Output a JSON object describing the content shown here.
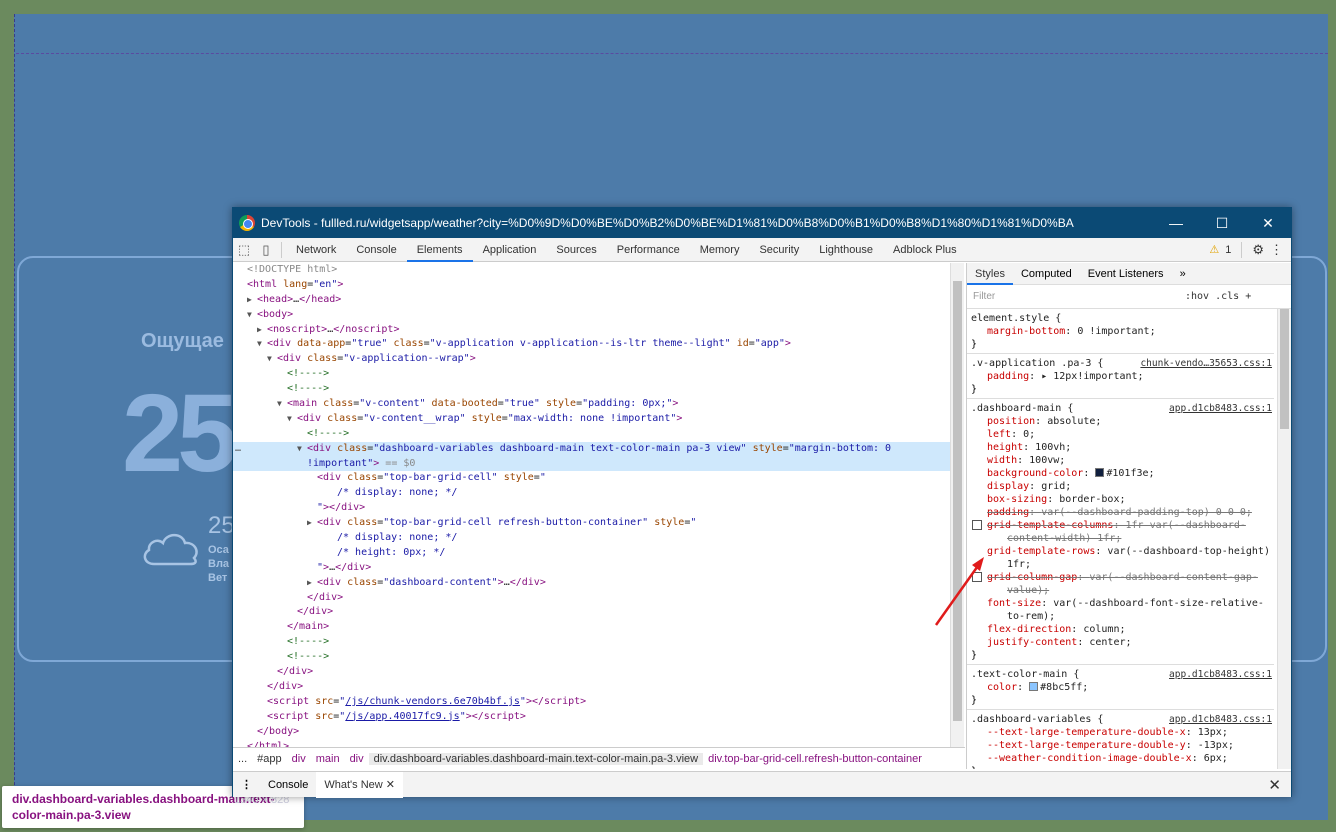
{
  "background": {
    "feels_text": "Ощущае",
    "big_temp": "25",
    "small_temp": "25",
    "lines": [
      "Оса",
      "Вла",
      "Вет"
    ],
    "tooltip": "div.dashboard-variables.dashboard-main.text-color-main.pa-3.view",
    "size": "1340 × 828"
  },
  "window": {
    "title": "DevTools - fullled.ru/widgetsapp/weather?city=%D0%9D%D0%BE%D0%B2%D0%BE%D1%81%D0%B8%D0%B1%D0%B8%D1%80%D1%81%D0%BA",
    "minimize": "—",
    "maximize": "☐",
    "close": "✕"
  },
  "tabs": [
    "Network",
    "Console",
    "Elements",
    "Application",
    "Sources",
    "Performance",
    "Memory",
    "Security",
    "Lighthouse",
    "Adblock Plus"
  ],
  "active_tab": "Elements",
  "warnings": "1",
  "elements": [
    {
      "i": 0,
      "h": "<span class='dim'>&lt;!DOCTYPE html&gt;</span>"
    },
    {
      "i": 0,
      "h": "<span class='tag'>&lt;html</span> <span class='an'>lang</span>=<span class='av'>\"en\"</span><span class='tag'>&gt;</span>"
    },
    {
      "i": 1,
      "t": "▶",
      "h": "<span class='tag'>&lt;head&gt;</span>…<span class='tag'>&lt;/head&gt;</span>"
    },
    {
      "i": 1,
      "t": "▼",
      "h": "<span class='tag'>&lt;body&gt;</span>"
    },
    {
      "i": 2,
      "t": "▶",
      "h": "<span class='tag'>&lt;noscript&gt;</span>…<span class='tag'>&lt;/noscript&gt;</span>"
    },
    {
      "i": 2,
      "t": "▼",
      "h": "<span class='tag'>&lt;div</span> <span class='an'>data-app</span>=<span class='av'>\"true\"</span> <span class='an'>class</span>=<span class='av'>\"v-application v-application--is-ltr theme--light\"</span> <span class='an'>id</span>=<span class='av'>\"app\"</span><span class='tag'>&gt;</span>"
    },
    {
      "i": 3,
      "t": "▼",
      "h": "<span class='tag'>&lt;div</span> <span class='an'>class</span>=<span class='av'>\"v-application--wrap\"</span><span class='tag'>&gt;</span>"
    },
    {
      "i": 4,
      "h": "<span class='cm'>&lt;!----&gt;</span>"
    },
    {
      "i": 4,
      "h": "<span class='cm'>&lt;!----&gt;</span>"
    },
    {
      "i": 4,
      "t": "▼",
      "h": "<span class='tag'>&lt;main</span> <span class='an'>class</span>=<span class='av'>\"v-content\"</span> <span class='an'>data-booted</span>=<span class='av'>\"true\"</span> <span class='an'>style</span>=<span class='av'>\"padding: 0px;\"</span><span class='tag'>&gt;</span>"
    },
    {
      "i": 5,
      "t": "▼",
      "h": "<span class='tag'>&lt;div</span> <span class='an'>class</span>=<span class='av'>\"v-content__wrap\"</span> <span class='an'>style</span>=<span class='av'>\"max-width: none !important\"</span><span class='tag'>&gt;</span>"
    },
    {
      "i": 6,
      "h": "<span class='cm'>&lt;!----&gt;</span>"
    },
    {
      "i": 6,
      "t": "▼",
      "sel": true,
      "h": "<span class='tag'>&lt;div</span> <span class='an'>class</span>=<span class='av'>\"dashboard-variables dashboard-main text-color-main pa-3 view\"</span> <span class='an'>style</span>=<span class='av'>\"margin-bottom: 0</span>"
    },
    {
      "i": 6,
      "sel": true,
      "h": "<span class='av'>!important\"</span><span class='tag'>&gt;</span> <span class='dim'>== $0</span>"
    },
    {
      "i": 7,
      "h": "<span class='tag'>&lt;div</span> <span class='an'>class</span>=<span class='av'>\"top-bar-grid-cell\"</span> <span class='an'>style</span>=<span class='av'>\"</span>"
    },
    {
      "i": 9,
      "h": "<span class='av'>/* display: none; */</span>"
    },
    {
      "i": 7,
      "h": "<span class='av'>\"</span><span class='tag'>&gt;&lt;/div&gt;</span>"
    },
    {
      "i": 7,
      "t": "▶",
      "h": "<span class='tag'>&lt;div</span> <span class='an'>class</span>=<span class='av'>\"top-bar-grid-cell refresh-button-container\"</span> <span class='an'>style</span>=<span class='av'>\"</span>"
    },
    {
      "i": 9,
      "h": "<span class='av'>/* display: none; */</span>"
    },
    {
      "i": 9,
      "h": "<span class='av'>/* height: 0px; */</span>"
    },
    {
      "i": 7,
      "h": "<span class='av'>\"</span><span class='tag'>&gt;</span>…<span class='tag'>&lt;/div&gt;</span>"
    },
    {
      "i": 7,
      "t": "▶",
      "h": "<span class='tag'>&lt;div</span> <span class='an'>class</span>=<span class='av'>\"dashboard-content\"</span><span class='tag'>&gt;</span>…<span class='tag'>&lt;/div&gt;</span>"
    },
    {
      "i": 6,
      "h": "<span class='tag'>&lt;/div&gt;</span>"
    },
    {
      "i": 5,
      "h": "<span class='tag'>&lt;/div&gt;</span>"
    },
    {
      "i": 4,
      "h": "<span class='tag'>&lt;/main&gt;</span>"
    },
    {
      "i": 4,
      "h": "<span class='cm'>&lt;!----&gt;</span>"
    },
    {
      "i": 4,
      "h": "<span class='cm'>&lt;!----&gt;</span>"
    },
    {
      "i": 3,
      "h": "<span class='tag'>&lt;/div&gt;</span>"
    },
    {
      "i": 2,
      "h": "<span class='tag'>&lt;/div&gt;</span>"
    },
    {
      "i": 2,
      "h": "<span class='tag'>&lt;script</span> <span class='an'>src</span>=<span class='av'>\"<span class='lk'>/js/chunk-vendors.6e70b4bf.js</span>\"</span><span class='tag'>&gt;&lt;/script&gt;</span>"
    },
    {
      "i": 2,
      "h": "<span class='tag'>&lt;script</span> <span class='an'>src</span>=<span class='av'>\"<span class='lk'>/js/app.40017fc9.js</span>\"</span><span class='tag'>&gt;&lt;/script&gt;</span>"
    },
    {
      "i": 1,
      "h": "<span class='tag'>&lt;/body&gt;</span>"
    },
    {
      "i": 0,
      "h": "<span class='tag'>&lt;/html&gt;</span>"
    }
  ],
  "breadcrumbs": [
    "...",
    "#app",
    "div",
    "main",
    "div",
    "div.dashboard-variables.dashboard-main.text-color-main.pa-3.view",
    "div.top-bar-grid-cell.refresh-button-container"
  ],
  "styles_tabs": [
    "Styles",
    "Computed",
    "Event Listeners",
    "»"
  ],
  "filter_placeholder": "Filter",
  "hov": ":hov",
  "cls": ".cls",
  "rules": [
    {
      "sel": "element.style {",
      "src": "",
      "decls": [
        {
          "p": "margin-bottom",
          "v": "0 !important;"
        }
      ]
    },
    {
      "sel": ".v-application .pa-3 {",
      "src": "chunk-vendo…35653.css:1",
      "decls": [
        {
          "p": "padding",
          "v": "▸ 12px!important;"
        }
      ]
    },
    {
      "sel": ".dashboard-main {",
      "src": "app.d1cb8483.css:1",
      "decls": [
        {
          "p": "position",
          "v": "absolute;"
        },
        {
          "p": "left",
          "v": "0;"
        },
        {
          "p": "height",
          "v": "100vh;"
        },
        {
          "p": "width",
          "v": "100vw;"
        },
        {
          "p": "background-color",
          "v": "#101f3e;",
          "sw": "#101f3e"
        },
        {
          "p": "display",
          "v": "grid;"
        },
        {
          "p": "box-sizing",
          "v": "border-box;"
        },
        {
          "p": "padding",
          "v": "var(--dashboard-padding-top) 0 0 0;",
          "s": true
        },
        {
          "p": "grid-template-columns",
          "v": "1fr var(--dashboard-",
          "s": true,
          "cb": true
        },
        {
          "c": "content-width) 1fr;",
          "s": true
        },
        {
          "p": "grid-template-rows",
          "v": "var(--dashboard-top-height)"
        },
        {
          "c": "1fr;"
        },
        {
          "p": "grid-column-gap",
          "v": "var(--dashboard-content-gap-",
          "s": true,
          "cb": true
        },
        {
          "c": "value);",
          "s": true
        },
        {
          "p": "font-size",
          "v": "var(--dashboard-font-size-relative-"
        },
        {
          "c": "to-rem);"
        },
        {
          "p": "flex-direction",
          "v": "column;"
        },
        {
          "p": "justify-content",
          "v": "center;"
        }
      ]
    },
    {
      "sel": ".text-color-main {",
      "src": "app.d1cb8483.css:1",
      "decls": [
        {
          "p": "color",
          "v": "#8bc5ff;",
          "sw": "#8bc5ff"
        }
      ]
    },
    {
      "sel": ".dashboard-variables {",
      "src": "app.d1cb8483.css:1",
      "decls": [
        {
          "p": "--text-large-temperature-double-x",
          "v": "13px;"
        },
        {
          "p": "--text-large-temperature-double-y",
          "v": "-13px;"
        },
        {
          "p": "--weather-condition-image-double-x",
          "v": "6px;"
        }
      ]
    }
  ],
  "drawer_tabs": [
    "Console",
    "What's New ✕"
  ],
  "drawer_close": "✕",
  "colors": {
    "titlebar": "#0b4a75",
    "accent": "#1a73e8",
    "selection": "#cfe8fc"
  }
}
